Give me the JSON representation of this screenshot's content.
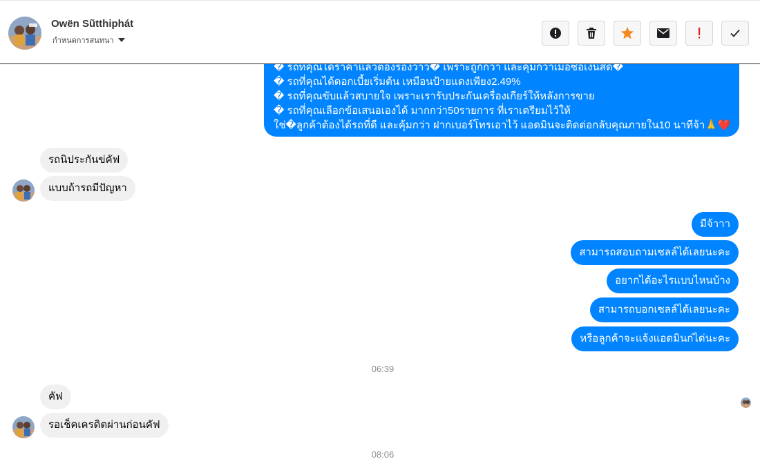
{
  "header": {
    "contact_name": "Owën Sũtthiphát",
    "subtitle": "กำหนดการสนทนา",
    "actions": [
      {
        "name": "report-icon",
        "label": "Report"
      },
      {
        "name": "trash-icon",
        "label": "Delete"
      },
      {
        "name": "star-icon",
        "label": "Star"
      },
      {
        "name": "envelope-icon",
        "label": "Mark unread"
      },
      {
        "name": "exclamation-icon",
        "label": "Important"
      },
      {
        "name": "checkmark-icon",
        "label": "Done"
      }
    ]
  },
  "colors": {
    "outgoing_bubble": "#0084ff",
    "incoming_bubble": "#f0f0f0",
    "star": "#f5871f",
    "exclamation": "#e02020"
  },
  "messages": {
    "promo_lines": [
      "� รถที่คุณได้ราคาแล้วต้องร้องว้าว� เพราะถูกกว่า และคุ้มกว่าเมื่อซื้อเงินสด�",
      "� รถที่คุณได้ดอกเบี้ยเริ่มต้น เหมือนป้ายแดงเพียง2.49%",
      "� รถที่คุณขับแล้วสบายใจ เพราะเรารับประกันเครื่องเกียร์ให้หลังการขาย",
      "� รถที่คุณเลือกข้อเสนอเองได้ มากกว่า50รายการ ที่เราเตรียมไว้ให้",
      "ใช่�ลูกค้าต้องได้รถที่ดี และคุ้มกว่า ฝากเบอร์โทรเอาไว้ แอดมินจะติดต่อกลับคุณภายใน10 นาทีจ้า🙏❤️"
    ],
    "in_1": "รถนิประกันข่คัฟ",
    "in_2": "แบบถ้ารถมีปัญหา",
    "out_1": "มีจ้าาา",
    "out_2": "สามารถสอบถามเซลล์ได้เลยนะคะ",
    "out_3": "อยากได้อะไรแบบไหนบ้าง",
    "out_4": "สามารถบอกเซลล์ได้เลยนะคะ",
    "out_5": "หรือลูกค้าจะแจ้งแอดมินก่ได่นะคะ",
    "time_1": "06:39",
    "in_3": "คัฟ",
    "in_4": "รอเช็คเครดิตผ่านก่อนคัฟ",
    "time_2": "08:06"
  }
}
